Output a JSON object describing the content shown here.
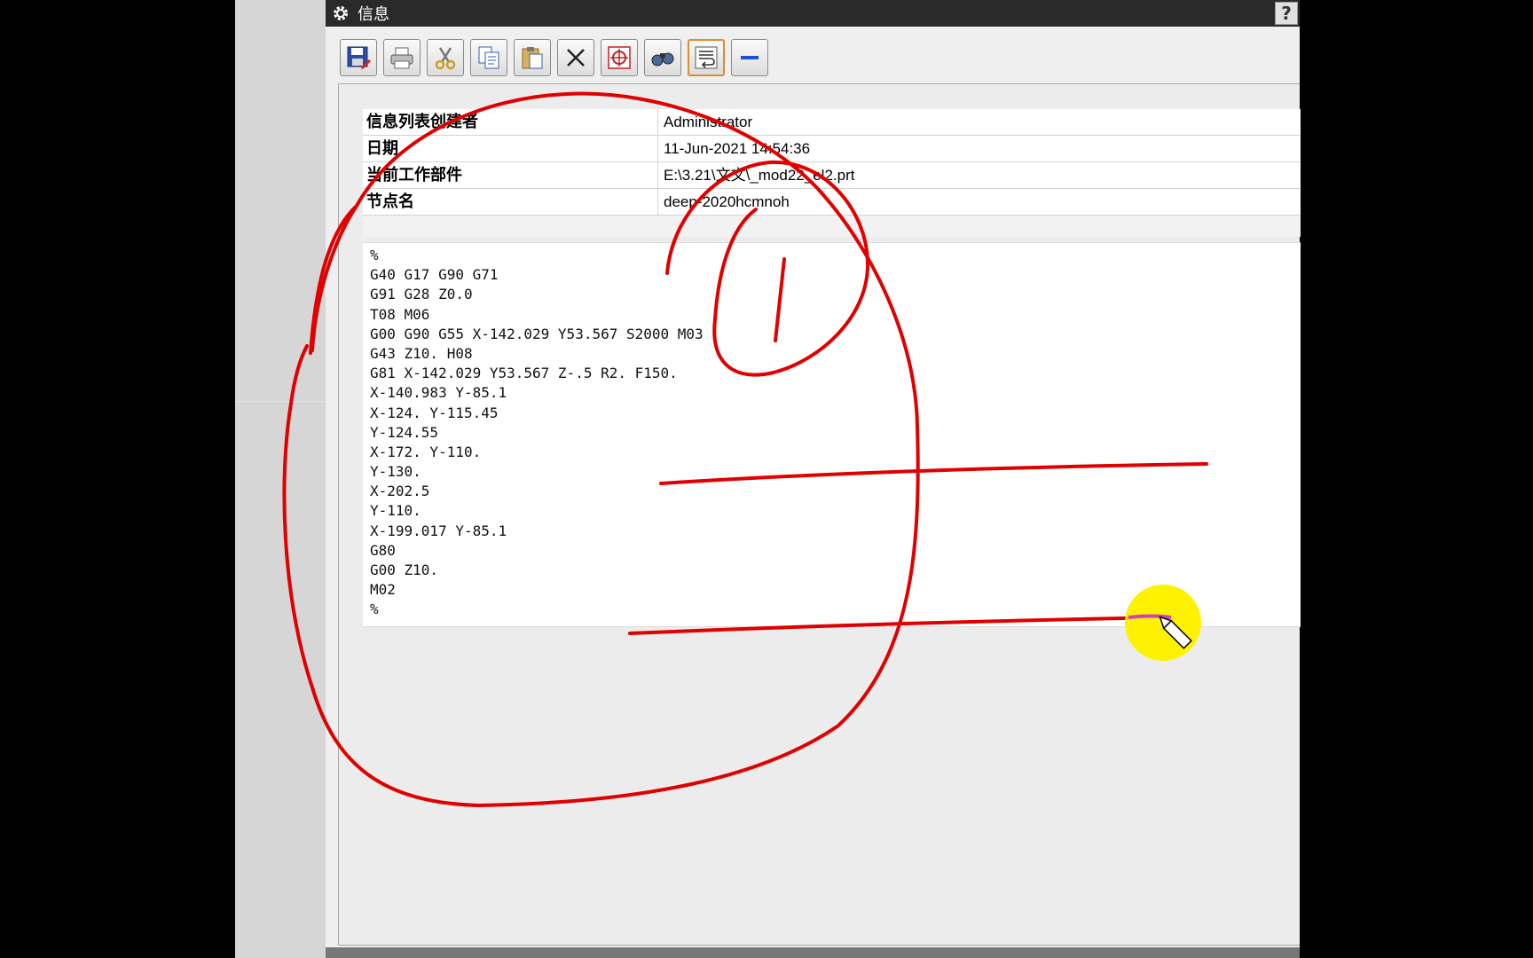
{
  "window": {
    "title": "信息",
    "help_label": "?",
    "icons": [
      "gear-icon"
    ]
  },
  "toolbar": {
    "buttons": [
      {
        "name": "save-button",
        "icon": "save-disk-icon"
      },
      {
        "name": "print-button",
        "icon": "printer-icon"
      },
      {
        "name": "cut-button",
        "icon": "scissors-icon"
      },
      {
        "name": "copy-button",
        "icon": "copy-icon"
      },
      {
        "name": "paste-button",
        "icon": "paste-clipboard-icon"
      },
      {
        "name": "delete-button",
        "icon": "cross-icon"
      },
      {
        "name": "target-button",
        "icon": "crosshair-icon"
      },
      {
        "name": "find-button",
        "icon": "binoculars-icon"
      },
      {
        "name": "word-wrap-button",
        "icon": "wrap-text-icon"
      },
      {
        "name": "minimize-button",
        "icon": "minus-icon"
      }
    ]
  },
  "info": {
    "rows": [
      {
        "key": "信息列表创建者",
        "value": "Administrator"
      },
      {
        "key": "日期",
        "value": "11-Jun-2021 14:54:36"
      },
      {
        "key": "当前工作部件",
        "value": "E:\\3.21\\文文\\_mod22_el2.prt"
      },
      {
        "key": "节点名",
        "value": "deep-2020hcmnoh"
      }
    ]
  },
  "code": {
    "lines": [
      "%",
      "G40 G17 G90 G71",
      "G91 G28 Z0.0",
      "T08 M06",
      "G00 G90 G55 X-142.029 Y53.567 S2000 M03",
      "G43 Z10. H08",
      "G81 X-142.029 Y53.567 Z-.5 R2. F150.",
      "X-140.983 Y-85.1",
      "X-124. Y-115.45",
      "Y-124.55",
      "X-172. Y-110.",
      "Y-130.",
      "X-202.5",
      "Y-110.",
      "X-199.017 Y-85.1",
      "G80",
      "G00 Z10.",
      "M02",
      "%"
    ]
  },
  "annotation": {
    "stroke_color": "#e00000",
    "highlight_color": "#fff200",
    "highlight_stroke_color": "#d040c0",
    "icons": [
      "pen-cursor-icon"
    ]
  }
}
